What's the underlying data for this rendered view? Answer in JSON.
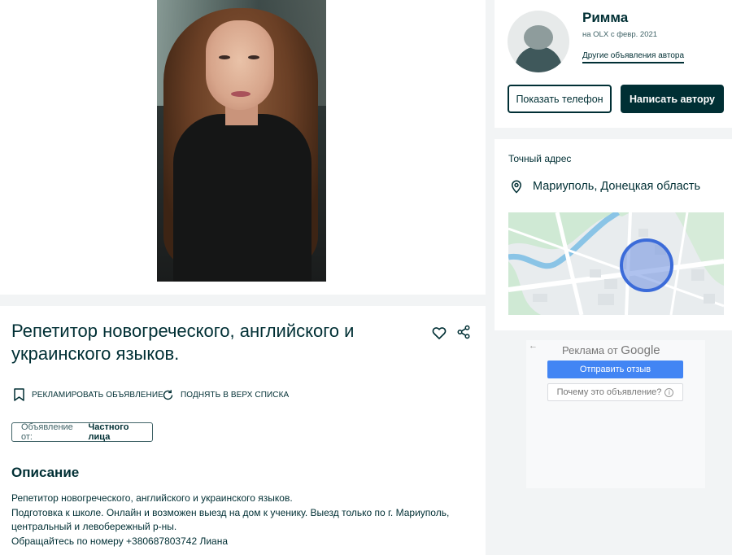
{
  "listing": {
    "title": "Репетитор новогреческого, английского и украинского языков.",
    "actions": {
      "promote": "РЕКЛАМИРОВАТЬ ОБЪЯВЛЕНИЕ",
      "bump": "ПОДНЯТЬ В ВЕРХ СПИСКА"
    },
    "owner_type_label": "Объявление от:",
    "owner_type_value": "Частного лица",
    "description_heading": "Описание",
    "description_lines": [
      "Репетитор новогреческого, английского и украинского языков.",
      "Подготовка к школе. Онлайн и возможен выезд на дом к ученику. Выезд только по г. Мариуполь,",
      "центральный и левобережный р-ны.",
      "Обращайтесь по номеру +380687803742 Лиана"
    ]
  },
  "seller": {
    "name": "Римма",
    "since": "на OLX с февр. 2021",
    "other_ads_link": "Другие объявления автора",
    "show_phone": "Показать телефон",
    "message": "Написать автору"
  },
  "address": {
    "label": "Точный адрес",
    "location": "Мариуполь, Донецкая область"
  },
  "google_ad": {
    "back": "←",
    "brand_prefix": "Реклама от",
    "brand_name": "Google",
    "send_feedback": "Отправить отзыв",
    "why_this_ad": "Почему это объявление?",
    "info_glyph": "i"
  },
  "colors": {
    "primary": "#002f34",
    "map_circle": "#3b6bd9",
    "google_blue": "#4285f4"
  },
  "icons": [
    "heart-icon",
    "share-icon",
    "bookmark-icon",
    "refresh-icon",
    "location-pin-icon"
  ]
}
